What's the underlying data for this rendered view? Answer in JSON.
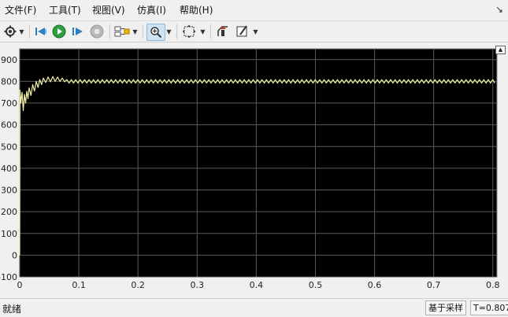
{
  "menu": {
    "file": "文件(F)",
    "tools": "工具(T)",
    "view": "视图(V)",
    "simulation": "仿真(I)",
    "help": "帮助(H)"
  },
  "toolbar": {
    "icons": [
      "gear-icon",
      "step-back-icon",
      "run-icon",
      "step-forward-icon",
      "stop-icon",
      "highlight-block-icon",
      "zoom-in-icon",
      "fit-to-view-icon",
      "cursor-measure-icon",
      "style-icon"
    ]
  },
  "colors": {
    "plot_bg": "#000000",
    "grid": "#5a5a5a",
    "axis_text": "#c8c8c8",
    "signal": "#f2f2a6",
    "toolbar_bg": "#f0f0f0"
  },
  "chart_data": {
    "type": "line",
    "x_ticks": [
      0,
      0.1,
      0.2,
      0.3,
      0.4,
      0.5,
      0.6,
      0.7,
      0.8
    ],
    "x_tick_labels": [
      "0",
      "0.1",
      "0.2",
      "0.3",
      "0.4",
      "0.5",
      "0.6",
      "0.7",
      "0.8"
    ],
    "y_ticks": [
      -100,
      0,
      100,
      200,
      300,
      400,
      500,
      600,
      700,
      800,
      900
    ],
    "y_tick_labels": [
      "-100",
      "0",
      "100",
      "200",
      "300",
      "400",
      "500",
      "600",
      "700",
      "800",
      "900"
    ],
    "xlim": [
      0,
      0.807
    ],
    "ylim": [
      -100,
      950
    ],
    "grid": true,
    "series": [
      {
        "steady_value": 800,
        "ripple_amplitude": 8,
        "ripple_period": 0.0075,
        "points": [
          [
            0,
            0
          ],
          [
            0.0005,
            760
          ],
          [
            0.002,
            700
          ],
          [
            0.004,
            750
          ],
          [
            0.006,
            665
          ],
          [
            0.008,
            740
          ],
          [
            0.01,
            700
          ],
          [
            0.012,
            755
          ],
          [
            0.014,
            720
          ],
          [
            0.016,
            770
          ],
          [
            0.019,
            735
          ],
          [
            0.022,
            785
          ],
          [
            0.025,
            755
          ],
          [
            0.028,
            800
          ],
          [
            0.031,
            772
          ],
          [
            0.034,
            808
          ],
          [
            0.037,
            785
          ],
          [
            0.04,
            815
          ],
          [
            0.044,
            795
          ],
          [
            0.048,
            820
          ],
          [
            0.052,
            798
          ],
          [
            0.056,
            822
          ],
          [
            0.06,
            800
          ],
          [
            0.064,
            820
          ],
          [
            0.068,
            800
          ],
          [
            0.072,
            815
          ],
          [
            0.076,
            798
          ]
        ]
      }
    ]
  },
  "status": {
    "left": "就绪",
    "mode": "基于采样",
    "time": "T=0.807"
  }
}
